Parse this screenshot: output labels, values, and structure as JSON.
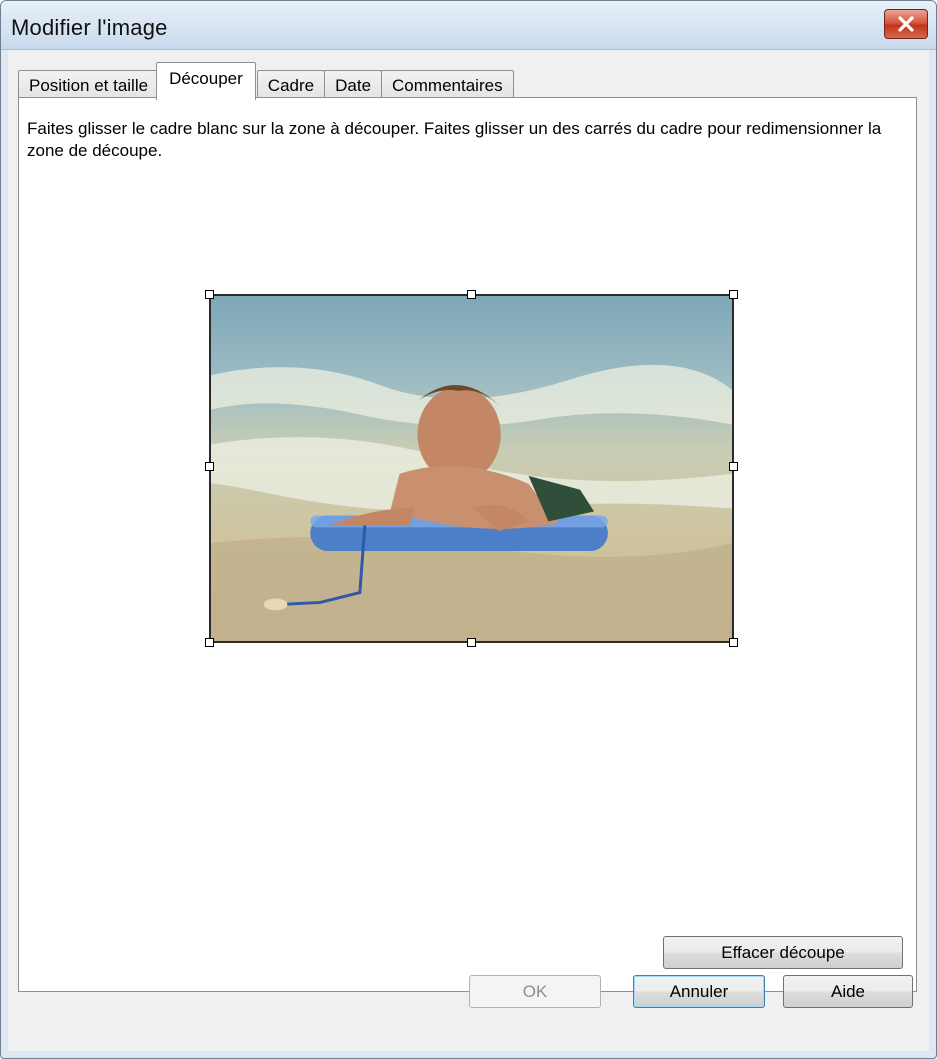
{
  "window": {
    "title": "Modifier l'image"
  },
  "tabs": [
    {
      "label": "Position et taille"
    },
    {
      "label": "Découper"
    },
    {
      "label": "Cadre"
    },
    {
      "label": "Date"
    },
    {
      "label": "Commentaires"
    }
  ],
  "active_tab": "Découper",
  "crop": {
    "instructions": "Faites glisser le cadre blanc sur la zone à découper. Faites glisser un des carrés du cadre pour redimensionner la zone de découpe.",
    "clear_label": "Effacer découpe"
  },
  "footer": {
    "ok_label": "OK",
    "cancel_label": "Annuler",
    "help_label": "Aide"
  },
  "colors": {
    "close_button": "#c2351b",
    "panel_background": "#ffffff",
    "dialog_background": "#f0f0f0"
  },
  "icons": {
    "close": "close-icon"
  }
}
